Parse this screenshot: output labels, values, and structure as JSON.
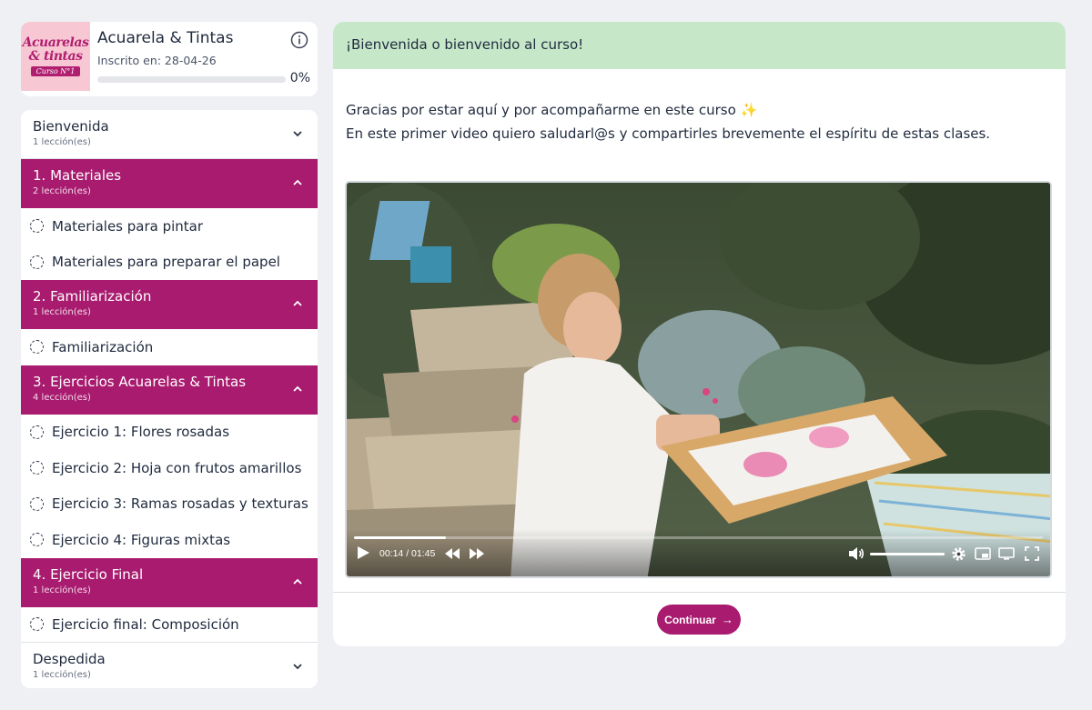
{
  "course": {
    "logo_line1": "Acuarelas",
    "logo_line2": "& tintas",
    "logo_line3": "Curso N°1",
    "title": "Acuarela & Tintas",
    "enrolled": "Inscrito en: 28-04-26",
    "progress_label": "0%",
    "progress_value": 0,
    "info_icon": "info-icon"
  },
  "sidebar": {
    "sections": [
      {
        "title": "Bienvenida",
        "count": "1 lección(es)",
        "open": false,
        "lessons": []
      },
      {
        "title": "1. Materiales",
        "count": "2 lección(es)",
        "open": true,
        "lessons": [
          "Materiales para pintar",
          "Materiales para preparar el papel"
        ]
      },
      {
        "title": "2. Familiarización",
        "count": "1 lección(es)",
        "open": true,
        "lessons": [
          "Familiarización"
        ]
      },
      {
        "title": "3. Ejercicios Acuarelas & Tintas",
        "count": "4 lección(es)",
        "open": true,
        "lessons": [
          "Ejercicio 1: Flores rosadas",
          "Ejercicio 2: Hoja con frutos amarillos",
          "Ejercicio 3: Ramas rosadas y texturas",
          "Ejercicio 4: Figuras mixtas"
        ]
      },
      {
        "title": "4. Ejercicio Final",
        "count": "1 lección(es)",
        "open": true,
        "lessons": [
          "Ejercicio final: Composición"
        ]
      },
      {
        "title": "Despedida",
        "count": "1 lección(es)",
        "open": false,
        "lessons": []
      }
    ]
  },
  "main": {
    "banner": "¡Bienvenida o bienvenido al curso!",
    "intro_line1": "Gracias por estar aquí y por acompañarme en este curso ✨",
    "intro_line2": "En este primer video quiero saludarl@s y compartirles brevemente el espíritu de estas clases.",
    "video": {
      "time": "00:14 / 01:45",
      "progress_fraction": 0.133,
      "volume_fraction": 1.0
    },
    "continue_label": "Continuar",
    "continue_arrow": "→"
  },
  "colors": {
    "accent": "#a81b6f",
    "banner_bg": "#c6e8c9",
    "page_bg": "#eff0f4"
  }
}
